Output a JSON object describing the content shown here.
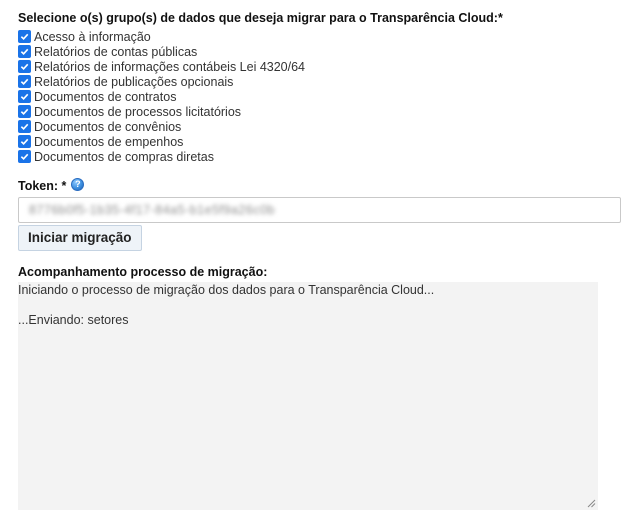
{
  "groups": {
    "title": "Selecione o(s) grupo(s) de dados que deseja migrar para o Transparência Cloud:*",
    "items": [
      {
        "label": "Acesso à informação",
        "checked": true
      },
      {
        "label": "Relatórios de contas públicas",
        "checked": true
      },
      {
        "label": "Relatórios de informações contábeis Lei 4320/64",
        "checked": true
      },
      {
        "label": "Relatórios de publicações opcionais",
        "checked": true
      },
      {
        "label": "Documentos de contratos",
        "checked": true
      },
      {
        "label": "Documentos de processos licitatórios",
        "checked": true
      },
      {
        "label": "Documentos de convênios",
        "checked": true
      },
      {
        "label": "Documentos de empenhos",
        "checked": true
      },
      {
        "label": "Documentos de compras diretas",
        "checked": true
      }
    ]
  },
  "token": {
    "label": "Token: *",
    "help_icon": "help-icon",
    "value": "8776b0f5-1b35-4f17-84a5-b1e5f9a26c0b"
  },
  "actions": {
    "start_label": "Iniciar migração"
  },
  "log": {
    "title": "Acompanhamento processo de migração:",
    "lines": [
      "Iniciando o processo de migração dos dados para o Transparência Cloud...",
      "",
      "...Enviando: setores"
    ]
  },
  "colors": {
    "checkbox": "#1a73e8",
    "log_background": "#f3f3f3",
    "button_background": "#eef3f8"
  }
}
